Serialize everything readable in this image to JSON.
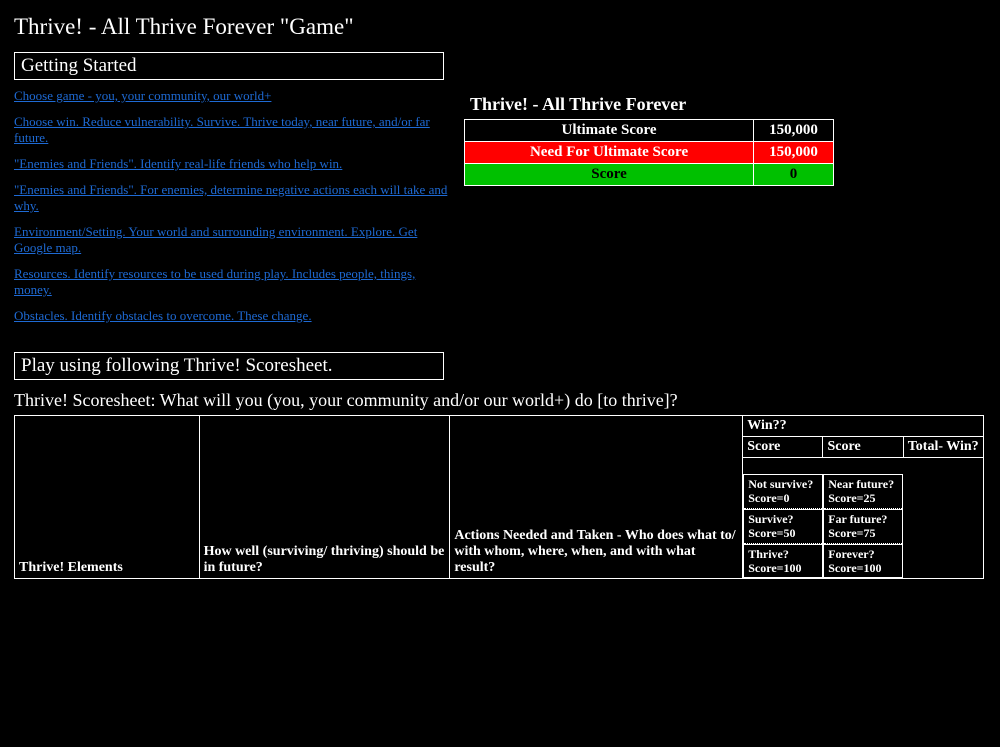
{
  "page": {
    "title": "Thrive! - All Thrive Forever \"Game\""
  },
  "getting_started": {
    "header": "Getting Started",
    "links": [
      "Choose game - you, your community, our world+",
      "Choose win. Reduce vulnerability. Survive. Thrive today, near future, and/or far future.",
      "\"Enemies and Friends\". Identify real-life friends who help win.",
      "\"Enemies and Friends\". For enemies, determine negative actions each will take and why.",
      "Environment/Setting. Your world and surrounding environment. Explore. Get Google map.",
      "Resources. Identify resources to be used during play. Includes people, things, money.",
      "Obstacles. Identify obstacles to overcome. These change."
    ]
  },
  "score_panel": {
    "title": "Thrive! - All Thrive Forever",
    "rows": [
      {
        "label": "Ultimate Score",
        "value": "150,000"
      },
      {
        "label": "Need For Ultimate Score",
        "value": "150,000"
      },
      {
        "label": "Score",
        "value": "0"
      }
    ]
  },
  "play_section": {
    "header": "Play using following Thrive! Scoresheet."
  },
  "scoresheet": {
    "title": "Thrive! Scoresheet: What will you (you, your community and/or our world+) do [to thrive]?",
    "columns": {
      "c1": "Thrive! Elements",
      "c2": "How well (surviving/ thriving) should be in future?",
      "c3": "Actions Needed and Taken  - Who does what to/ with whom, where, when, and with what result?",
      "win": "Win??",
      "score1": "Score",
      "score2": "Score",
      "total": "Total- Win?"
    },
    "legend": {
      "left": [
        {
          "q": "Not survive?",
          "s": "Score=0"
        },
        {
          "q": "Survive?",
          "s": "Score=50"
        },
        {
          "q": "Thrive?",
          "s": "Score=100"
        }
      ],
      "right": [
        {
          "q": "Near future?",
          "s": "Score=25"
        },
        {
          "q": "Far future?",
          "s": "Score=75"
        },
        {
          "q": "Forever?",
          "s": "Score=100"
        }
      ]
    }
  }
}
